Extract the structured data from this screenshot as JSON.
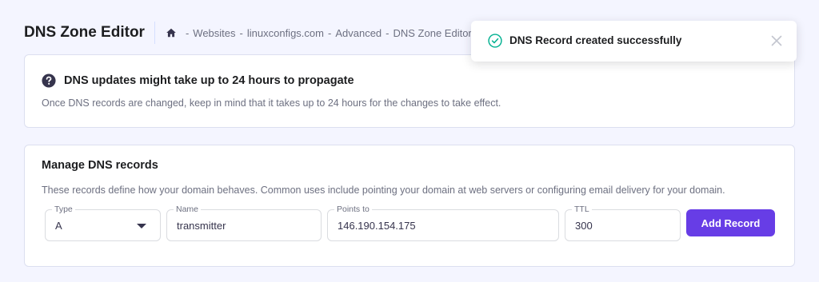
{
  "header": {
    "title": "DNS Zone Editor",
    "breadcrumb": [
      "Websites",
      "linuxconfigs.com",
      "Advanced",
      "DNS Zone Editor"
    ],
    "separator": "-",
    "home_icon": "home-icon"
  },
  "info_card": {
    "icon": "help-circle-icon",
    "title": "DNS updates might take up to 24 hours to propagate",
    "text": "Once DNS records are changed, keep in mind that it takes up to 24 hours for the changes to take effect."
  },
  "manage_card": {
    "title": "Manage DNS records",
    "text": "These records define how your domain behaves. Common uses include pointing your domain at web servers or configuring email delivery for your domain.",
    "fields": {
      "type": {
        "label": "Type",
        "value": "A"
      },
      "name": {
        "label": "Name",
        "value": "transmitter"
      },
      "points_to": {
        "label": "Points to",
        "value": "146.190.154.175"
      },
      "ttl": {
        "label": "TTL",
        "value": "300"
      }
    },
    "add_button": "Add Record"
  },
  "toast": {
    "message": "DNS Record created successfully",
    "icon": "check-circle-icon"
  },
  "colors": {
    "accent": "#673de6",
    "success": "#00b090",
    "background": "#f4f5ff"
  }
}
